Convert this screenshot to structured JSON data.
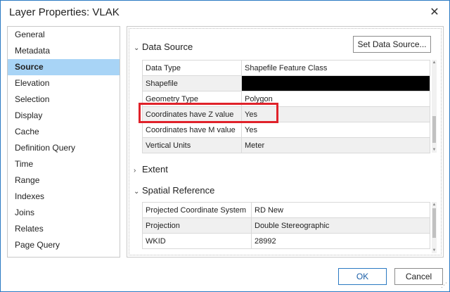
{
  "window": {
    "title": "Layer Properties: VLAK",
    "close_glyph": "✕"
  },
  "sidebar": {
    "items": [
      {
        "label": "General"
      },
      {
        "label": "Metadata"
      },
      {
        "label": "Source",
        "selected": true
      },
      {
        "label": "Elevation"
      },
      {
        "label": "Selection"
      },
      {
        "label": "Display"
      },
      {
        "label": "Cache"
      },
      {
        "label": "Definition Query"
      },
      {
        "label": "Time"
      },
      {
        "label": "Range"
      },
      {
        "label": "Indexes"
      },
      {
        "label": "Joins"
      },
      {
        "label": "Relates"
      },
      {
        "label": "Page Query"
      }
    ]
  },
  "content": {
    "data_source": {
      "header": "Data Source",
      "set_button": "Set Data Source...",
      "rows": [
        {
          "key": "Data Type",
          "value": "Shapefile Feature Class"
        },
        {
          "key": "Shapefile",
          "value": "",
          "redacted": true
        },
        {
          "key": "Geometry Type",
          "value": "Polygon"
        },
        {
          "key": "Coordinates have Z value",
          "value": "Yes",
          "highlighted": true
        },
        {
          "key": "Coordinates have M value",
          "value": "Yes"
        },
        {
          "key": "Vertical Units",
          "value": "Meter"
        }
      ]
    },
    "extent": {
      "header": "Extent"
    },
    "spatial_reference": {
      "header": "Spatial Reference",
      "rows": [
        {
          "key": "Projected Coordinate System",
          "value": "RD New"
        },
        {
          "key": "Projection",
          "value": "Double Stereographic"
        },
        {
          "key": "WKID",
          "value": "28992"
        }
      ]
    }
  },
  "footer": {
    "ok_label": "OK",
    "cancel_label": "Cancel"
  },
  "colors": {
    "selection": "#a8d4f6",
    "highlight": "#e0222a",
    "border_accent": "#2b79c2"
  },
  "icons": {
    "expanded": "chevron-down-icon",
    "collapsed": "chevron-right-icon"
  }
}
